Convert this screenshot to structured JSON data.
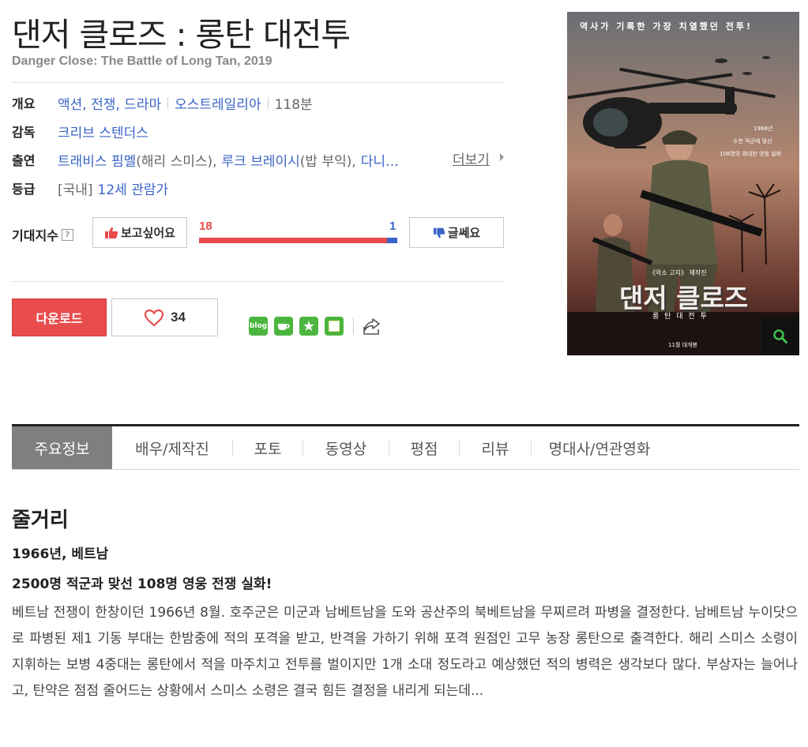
{
  "movie": {
    "title": "댄저 클로즈 : 롱탄 대전투",
    "subtitle": "Danger Close: The Battle of Long Tan, 2019"
  },
  "info": {
    "overview_label": "개요",
    "genres": "액션, 전쟁, 드라마",
    "country": "오스트레일리아",
    "runtime": "118분",
    "director_label": "감독",
    "director": "크리브 스텐더스",
    "cast_label": "출연",
    "cast_1_name": "트래비스 핌멜",
    "cast_1_role": "(해리 스미스),",
    "cast_2_name": "루크 브레이시",
    "cast_2_role": "(밥 부익),",
    "cast_3_name": "다니…",
    "more_label": "더보기",
    "rating_label": "등급",
    "rating_region": "[국내]",
    "rating_value": "12세 관람가"
  },
  "expectation": {
    "label": "기대지수",
    "want_label": "보고싶어요",
    "meh_label": "글쎄요",
    "want_count": "18",
    "meh_count": "1",
    "want_color": "#e94c4c",
    "meh_color": "#3a64c7",
    "want_fraction": 0.947
  },
  "actions": {
    "download_label": "다운로드",
    "like_count": "34",
    "share_icons": [
      "blog-icon",
      "cafe-icon",
      "star-bookmark-icon",
      "memo-icon"
    ]
  },
  "poster": {
    "tagline": "역사가 기록한 가장 치열했던 전투!",
    "info_1": "1966년",
    "info_2": "수천 적군에 맞선",
    "info_3": "108명의 위대한 영웅 실화",
    "credit": "《락소 고지》 제작진",
    "logo_title": "댄저 클로즈",
    "logo_sub": "롱 탄 대 전 투",
    "release": "11월 대개봉"
  },
  "tabs": [
    {
      "label": "주요정보"
    },
    {
      "label": "배우/제작진"
    },
    {
      "label": "포토"
    },
    {
      "label": "동영상"
    },
    {
      "label": "평점"
    },
    {
      "label": "리뷰"
    },
    {
      "label": "명대사/연관영화"
    }
  ],
  "plot": {
    "heading": "줄거리",
    "line1": "1966년, 베트남",
    "line2": "2500명 적군과 맞선 108명 영웅 전쟁 실화!",
    "body": "베트남 전쟁이 한창이던 1966년 8월. 호주군은 미군과 남베트남을 도와 공산주의 북베트남을 무찌르려 파병을 결정한다. 남베트남 누이닷으로 파병된 제1 기동 부대는 한밤중에 적의 포격을 받고, 반격을 가하기 위해 포격 원점인 고무 농장 롱탄으로 출격한다. 해리 스미스 소령이 지휘하는 보병 4중대는 롱탄에서 적을 마주치고 전투를 벌이지만 1개 소대 정도라고 예상했던 적의 병력은 생각보다 많다. 부상자는 늘어나고, 탄약은 점점 줄어드는 상황에서 스미스 소령은 결국 힘든 결정을 내리게 되는데..."
  }
}
